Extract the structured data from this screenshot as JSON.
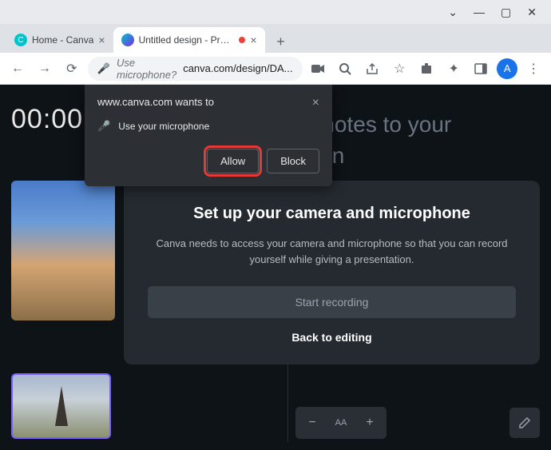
{
  "window": {
    "minimize": "—",
    "maximize": "▢",
    "close": "✕",
    "dropdown": "⌄"
  },
  "tabs": {
    "t0": {
      "title": "Home - Canva",
      "favicon_letter": "C"
    },
    "t1": {
      "title": "Untitled design - Presen"
    },
    "new_tab": "+"
  },
  "toolbar": {
    "prompt": "Use microphone?",
    "url": "canva.com/design/DA...",
    "avatar_letter": "A"
  },
  "page": {
    "timer": "00:00",
    "bg_text_l1": "d notes to your",
    "bg_text_l2": "sign"
  },
  "setup": {
    "title": "Set up your camera and microphone",
    "desc": "Canva needs to access your camera and microphone so that you can record yourself while giving a presentation.",
    "start": "Start recording",
    "back": "Back to editing"
  },
  "zoom": {
    "label": "AA"
  },
  "permission": {
    "title": "www.canva.com wants to",
    "item": "Use your microphone",
    "allow": "Allow",
    "block": "Block"
  }
}
